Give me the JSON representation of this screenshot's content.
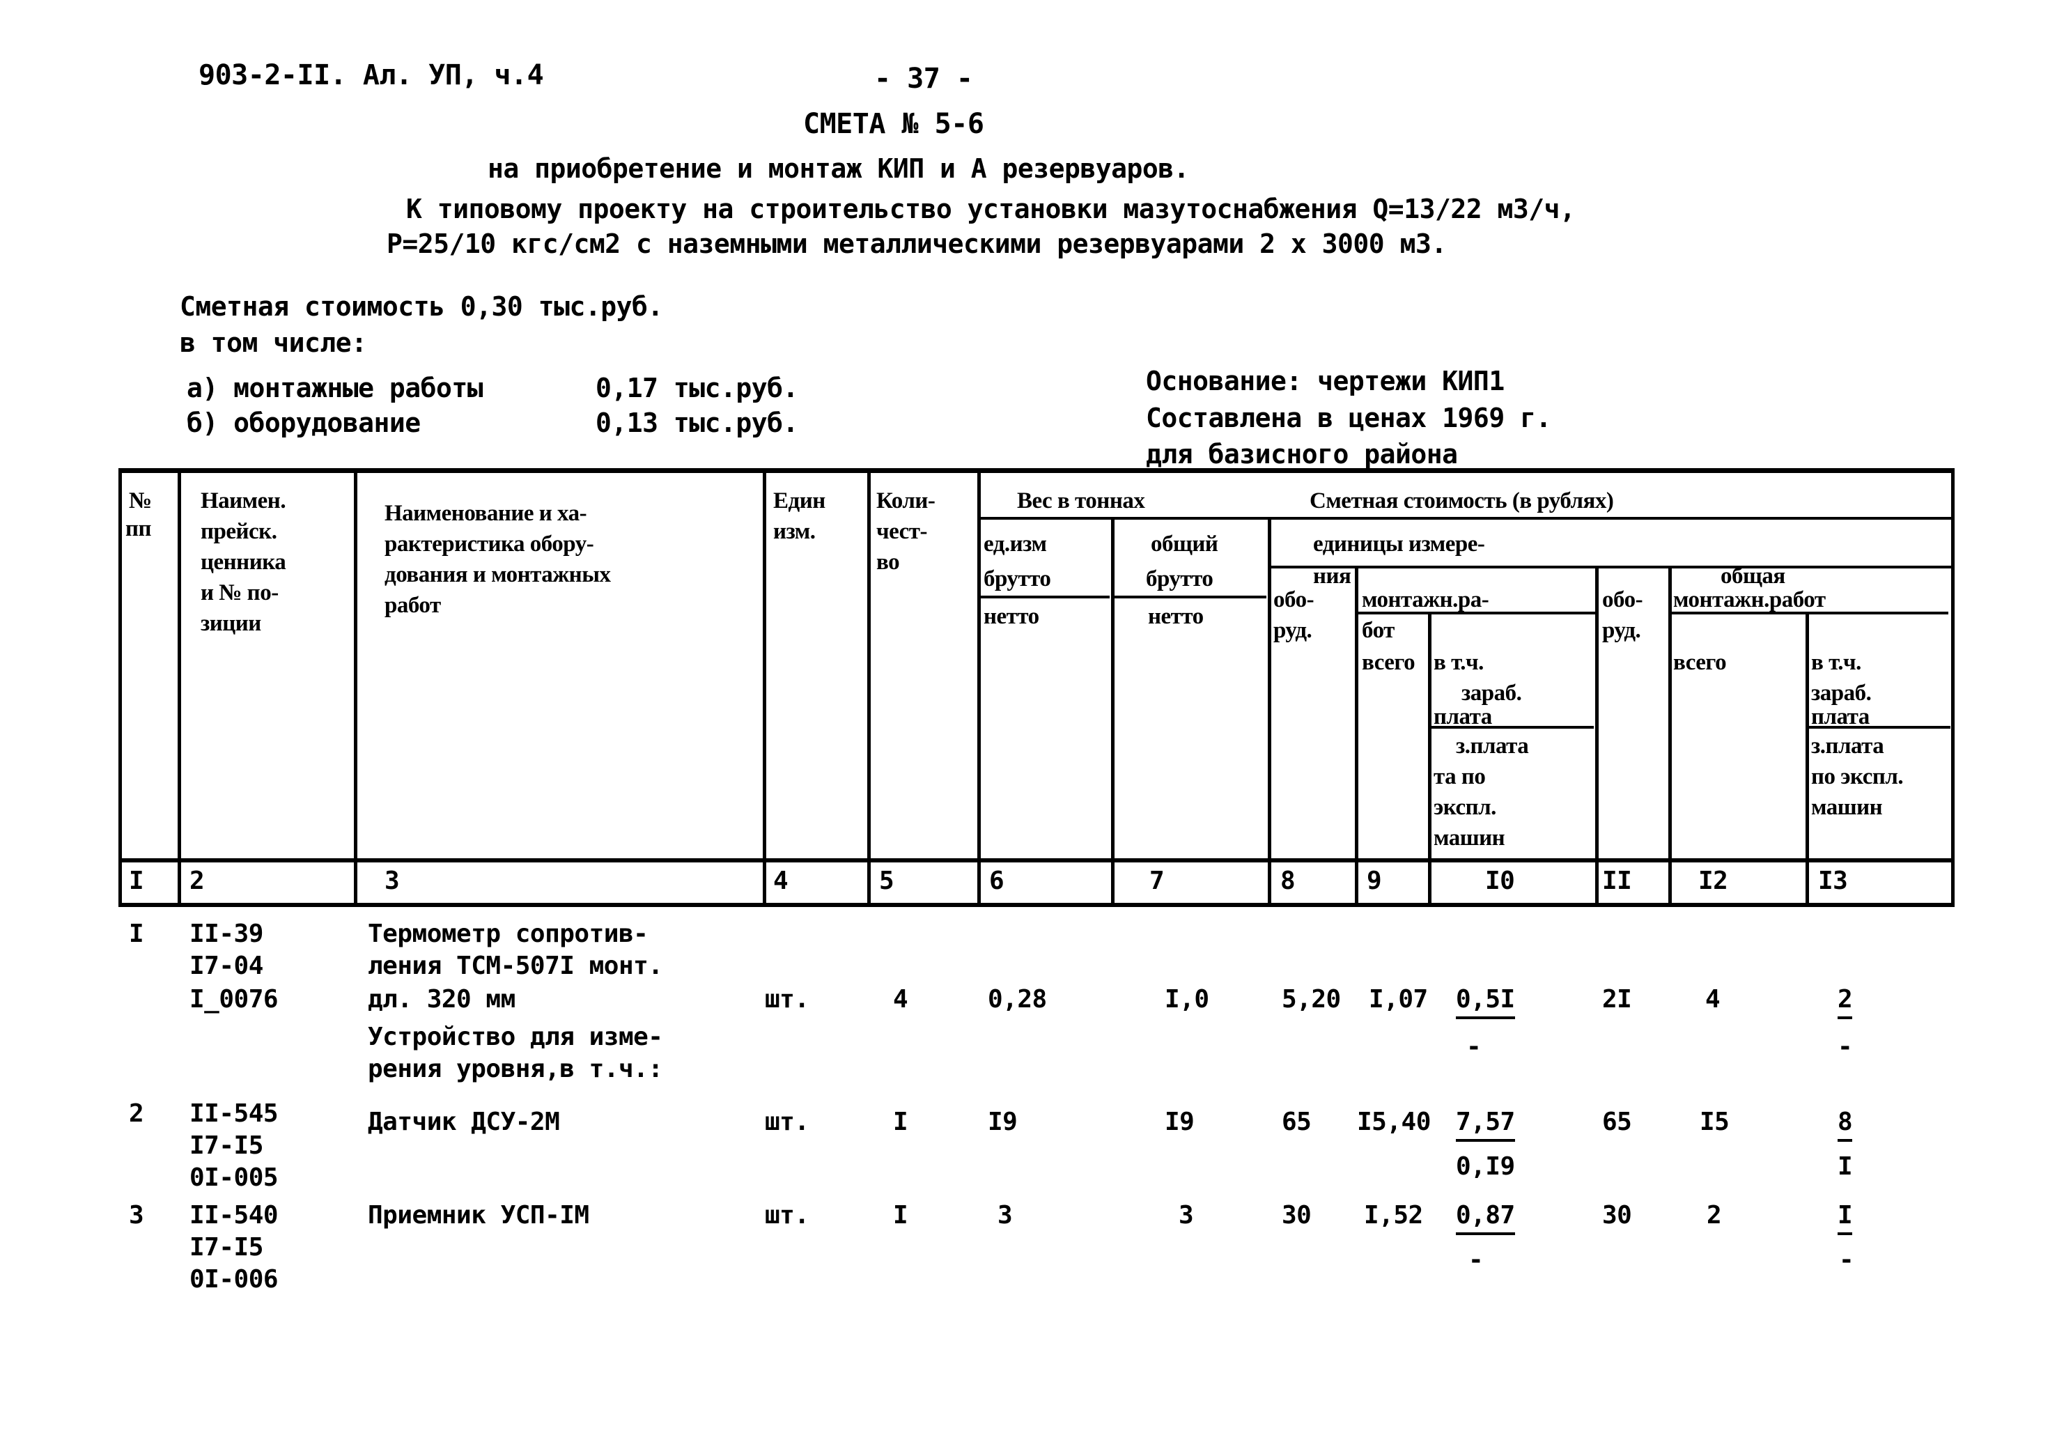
{
  "header": {
    "doc_code": "903-2-II. Ал. УП, ч.4",
    "page_number": "- 37 -",
    "estimate_title": "СМЕТА № 5-6",
    "subtitle_line1": "на приобретение и монтаж КИП и А резервуаров.",
    "subtitle_line2": "К типовому проекту на строительство установки мазутоснабжения Q=13/22 м3/ч,",
    "subtitle_line3": "Р=25/10 кгс/см2 с наземными металлическими резервуарами 2 х 3000 м3."
  },
  "summary": {
    "total_label": "Сметная стоимость 0,30 тыс.руб.",
    "including_label": "в том числе:",
    "a_label": "а) монтажные работы",
    "a_value": "0,17 тыс.руб.",
    "b_label": "б) оборудование",
    "b_value": "0,13 тыс.руб."
  },
  "basis": {
    "line1": "Основание: чертежи КИП1",
    "line2": "Составлена в ценах 1969 г.",
    "line3": "для базисного района"
  },
  "table": {
    "headers": {
      "col1": "№ пп",
      "col1_a": "№",
      "col1_b": "пп",
      "col2": "Наимен. прейск. ценника и № позиции",
      "col2_l1": "Наимен.",
      "col2_l2": "прейск.",
      "col2_l3": "ценника",
      "col2_l4": "и № по-",
      "col2_l5": "зиции",
      "col3_l1": "Наименование и ха-",
      "col3_l2": "рактеристика обору-",
      "col3_l3": "дования и монтажных",
      "col3_l4": "работ",
      "col4_l1": "Един",
      "col4_l2": "изм.",
      "col5_l1": "Коли-",
      "col5_l2": "чест-",
      "col5_l3": "во",
      "weight_group": "Вес в тоннах",
      "weight_unit_l1": "ед.изм",
      "weight_unit_l2": "брутто",
      "weight_unit_l3": "нетто",
      "weight_total_l1": "общий",
      "weight_total_l2": "брутто",
      "weight_total_l3": "нетто",
      "cost_group": "Сметная стоимость (в рублях)",
      "unit_group_l1": "единицы измере-",
      "unit_group_l2": "ния",
      "total_group": "общая",
      "obor_l1": "обо-",
      "obor_l2": "руд.",
      "mont_l1": "монтажн.ра-",
      "mont_l2": "бот",
      "vsego": "всего",
      "vtch": "в т.ч.",
      "zarab": "зараб.",
      "plata": "плата",
      "zplata_l1": "з.плата",
      "zplata_l2": "та по",
      "zplata_l3": "экспл.",
      "zplata_l4": "машин",
      "obor2_l1": "обо-",
      "obor2_l2": "руд.",
      "mont2": "монтажн.работ",
      "vsego2": "всего",
      "vtch2": "в т.ч.",
      "zarab2": "зараб.",
      "plata2": "плата",
      "zplata2_l1": "з.плата",
      "zplata2_l2": "по экспл.",
      "zplata2_l3": "машин"
    },
    "column_numbers": [
      "I",
      "2",
      "3",
      "4",
      "5",
      "6",
      "7",
      "8",
      "9",
      "I0",
      "II",
      "I2",
      "I3"
    ],
    "rows": [
      {
        "num": "I",
        "price_ref_l1": "II-39",
        "price_ref_l2": "I7-04",
        "price_ref_l3": "I_0076",
        "name_l1": "Термометр сопротив-",
        "name_l2": "ления ТСМ-507I монт.",
        "name_l3": "дл. 320 мм",
        "unit": "шт.",
        "qty": "4",
        "weight_unit": "0,28",
        "weight_total": "I,0",
        "unit_equip": "5,20",
        "unit_mont_total": "I,07",
        "unit_mont_wage": "0,5I",
        "unit_mont_wage2": "-",
        "total_equip": "2I",
        "total_mont": "4",
        "total_wage": "2",
        "total_wage2": "-"
      },
      {
        "num": "",
        "price_ref_l1": "",
        "price_ref_l2": "",
        "price_ref_l3": "",
        "name_l1": "Устройство для изме-",
        "name_l2": "рения уровня,в т.ч.:",
        "name_l3": "",
        "unit": "",
        "qty": "",
        "weight_unit": "",
        "weight_total": "",
        "unit_equip": "",
        "unit_mont_total": "",
        "unit_mont_wage": "",
        "unit_mont_wage2": "",
        "total_equip": "",
        "total_mont": "",
        "total_wage": "",
        "total_wage2": ""
      },
      {
        "num": "2",
        "price_ref_l1": "II-545",
        "price_ref_l2": "I7-I5",
        "price_ref_l3": "0I-005",
        "name_l1": "Датчик ДСУ-2М",
        "name_l2": "",
        "name_l3": "",
        "unit": "шт.",
        "qty": "I",
        "weight_unit": "I9",
        "weight_total": "I9",
        "unit_equip": "65",
        "unit_mont_total": "I5,40",
        "unit_mont_wage": "7,57",
        "unit_mont_wage2": "0,I9",
        "total_equip": "65",
        "total_mont": "I5",
        "total_wage": "8",
        "total_wage2": "I"
      },
      {
        "num": "3",
        "price_ref_l1": "II-540",
        "price_ref_l2": "I7-I5",
        "price_ref_l3": "0I-006",
        "name_l1": "Приемник УСП-IМ",
        "name_l2": "",
        "name_l3": "",
        "unit": "шт.",
        "qty": "I",
        "weight_unit": "3",
        "weight_total": "3",
        "unit_equip": "30",
        "unit_mont_total": "I,52",
        "unit_mont_wage": "0,87",
        "unit_mont_wage2": "-",
        "total_equip": "30",
        "total_mont": "2",
        "total_wage": "I",
        "total_wage2": "-"
      }
    ]
  }
}
